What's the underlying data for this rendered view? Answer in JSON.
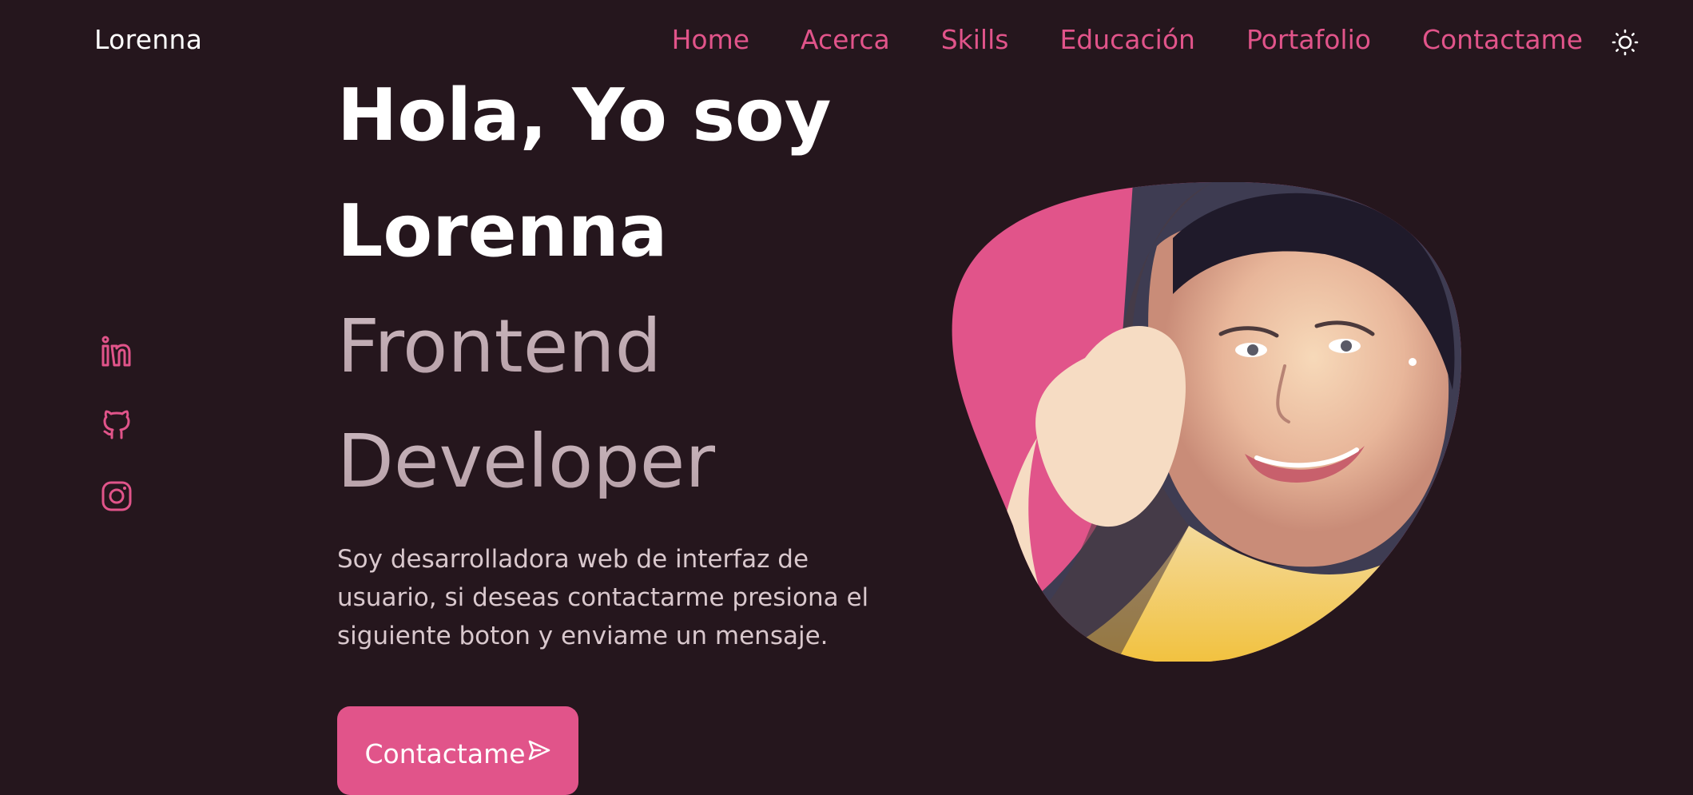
{
  "header": {
    "brand": "Lorenna",
    "nav": [
      "Home",
      "Acerca",
      "Skills",
      "Educación",
      "Portafolio",
      "Contactame"
    ],
    "theme_icon": "sun-icon"
  },
  "social": {
    "icons": [
      "linkedin-icon",
      "github-icon",
      "instagram-icon"
    ]
  },
  "hero": {
    "line1": "Hola, Yo soy",
    "line2": "Lorenna",
    "line3": "Frontend",
    "line4": "Developer",
    "description": "Soy desarrolladora web de interfaz de usuario, si deseas contactarme presiona el siguiente boton y enviame un mensaje.",
    "cta_label": "Contactame",
    "cta_icon": "send-icon"
  },
  "colors": {
    "background": "#25161d",
    "accent": "#e1548a",
    "text_white": "#ffffff",
    "text_muted": "#d9c8cd"
  }
}
